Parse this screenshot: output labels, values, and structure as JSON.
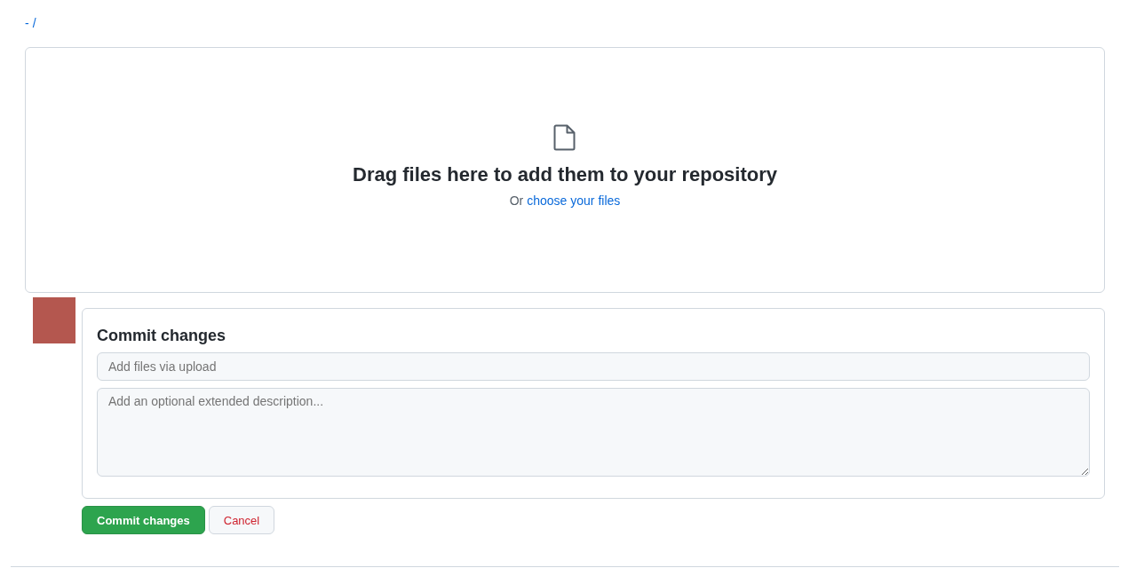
{
  "breadcrumb": {
    "repo": "-",
    "separator": "/"
  },
  "dropzone": {
    "heading": "Drag files here to add them to your repository",
    "prefix": "Or",
    "link": "choose your files"
  },
  "commit": {
    "title": "Commit changes",
    "summary_placeholder": "Add files via upload",
    "description_placeholder": "Add an optional extended description..."
  },
  "buttons": [
    {
      "label": "Commit changes",
      "kind": "primary"
    },
    {
      "label": "Cancel",
      "kind": "danger"
    }
  ]
}
